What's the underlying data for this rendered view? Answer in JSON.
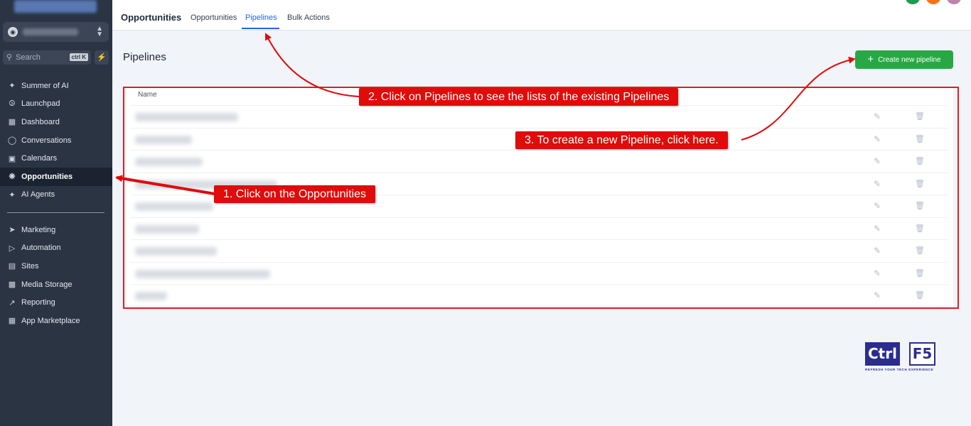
{
  "sidebar": {
    "search_placeholder": "Search",
    "search_shortcut": "ctrl K",
    "items_top": [
      {
        "label": "Summer of AI",
        "icon": "sparkle-icon"
      },
      {
        "label": "Launchpad",
        "icon": "rocket-icon"
      },
      {
        "label": "Dashboard",
        "icon": "grid-icon"
      },
      {
        "label": "Conversations",
        "icon": "chat-icon"
      },
      {
        "label": "Calendars",
        "icon": "calendar-icon"
      },
      {
        "label": "Opportunities",
        "icon": "opportunities-icon",
        "active": true
      },
      {
        "label": "AI Agents",
        "icon": "sparkle-icon"
      }
    ],
    "items_bottom": [
      {
        "label": "Marketing",
        "icon": "send-icon"
      },
      {
        "label": "Automation",
        "icon": "automation-icon"
      },
      {
        "label": "Sites",
        "icon": "sites-icon"
      },
      {
        "label": "Media Storage",
        "icon": "image-icon"
      },
      {
        "label": "Reporting",
        "icon": "trend-icon"
      },
      {
        "label": "App Marketplace",
        "icon": "apps-icon"
      }
    ]
  },
  "header": {
    "title": "Opportunities",
    "tabs": [
      {
        "label": "Opportunities"
      },
      {
        "label": "Pipelines",
        "active": true
      },
      {
        "label": "Bulk Actions"
      }
    ]
  },
  "main": {
    "page_title": "Pipelines",
    "create_button": "Create new pipeline",
    "table": {
      "column_name": "Name",
      "row_count": 9
    }
  },
  "annotations": {
    "step1": "1. Click on the Opportunities",
    "step2": "2. Click on Pipelines to see the lists of the existing Pipelines",
    "step3": "3. To create a new Pipeline, click here."
  },
  "watermark": {
    "brand": "Ctrl F5",
    "tagline": "REFRESH YOUR TECH EXPERIENCE"
  },
  "colors": {
    "sidebar_bg": "#2a3443",
    "accent_blue": "#2563eb",
    "create_green": "#27a844",
    "annotation_red": "#e00b0b"
  }
}
